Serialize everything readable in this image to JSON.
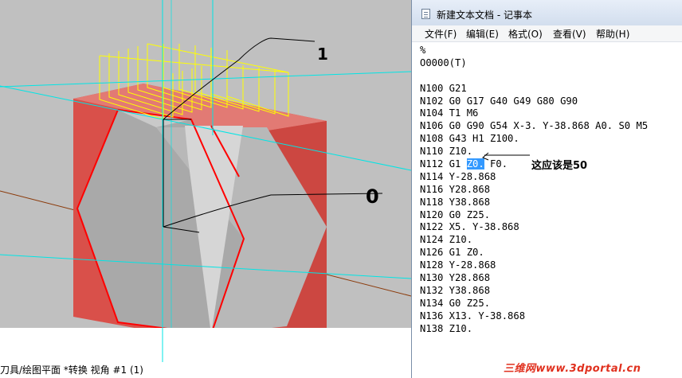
{
  "cad": {
    "status_text": "刀具/绘图平面 *转换 视角 #1 (1)",
    "label_1": "1",
    "label_0": "0"
  },
  "notepad": {
    "title": "新建文本文档 - 记事本",
    "menu": [
      "文件(F)",
      "编辑(E)",
      "格式(O)",
      "查看(V)",
      "帮助(H)"
    ],
    "lines": [
      "%",
      "O0000(T)",
      "",
      "N100 G21",
      "N102 G0 G17 G40 G49 G80 G90",
      "N104 T1 M6",
      "N106 G0 G90 G54 X-3. Y-38.868 A0. S0 M5",
      "N108 G43 H1 Z100.",
      "N110 Z10.",
      "N112 G1 Z0. F0.",
      "N114 Y-28.868",
      "N116 Y28.868",
      "N118 Y38.868",
      "N120 G0 Z25.",
      "N122 X5. Y-38.868",
      "N124 Z10.",
      "N126 G1 Z0.",
      "N128 Y-28.868",
      "N130 Y28.868",
      "N132 Y38.868",
      "N134 G0 Z25.",
      "N136 X13. Y-38.868",
      "N138 Z10."
    ],
    "highlight": {
      "line": 9,
      "before": "N112 G1 ",
      "selected": "Z0.",
      "after": " F0."
    },
    "annotation": "这应该是50"
  },
  "watermark": "三维网www.3dportal.cn",
  "colors": {
    "viewport_bg": "#c0c0c0",
    "block_red": "#d9504a",
    "block_edge": "#ff0000",
    "axis_cyan": "#00e5e5",
    "axis_brown": "#8b3a0a",
    "toolpath_yellow": "#ffff00",
    "selection_blue": "#3399ff"
  }
}
